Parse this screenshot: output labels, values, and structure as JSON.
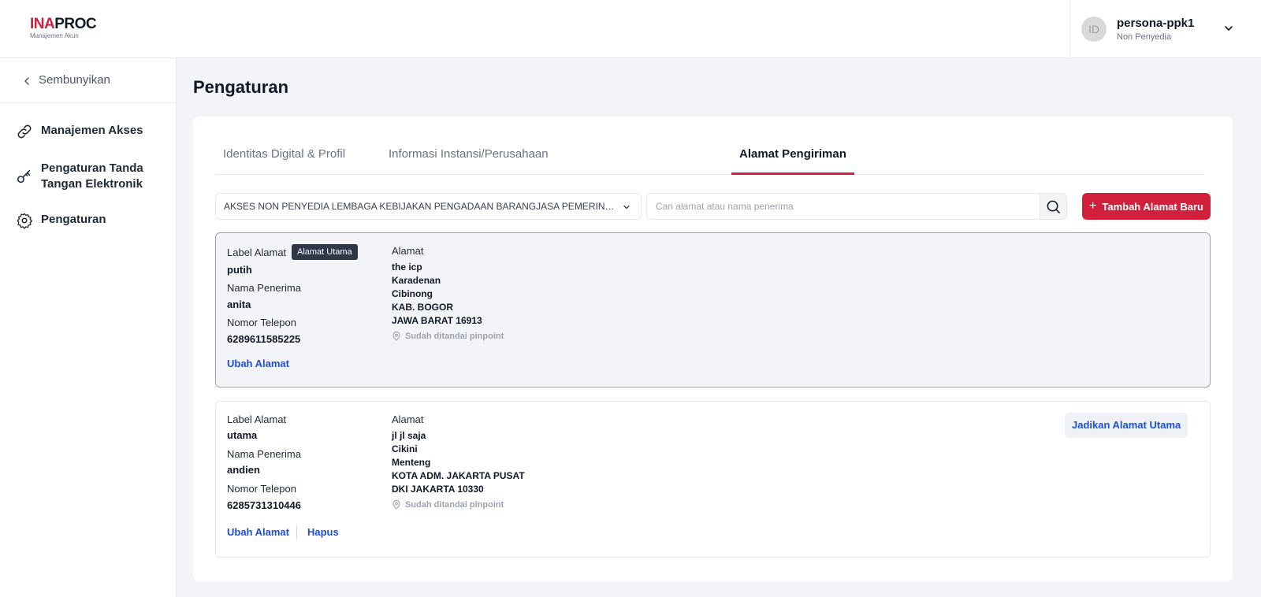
{
  "header": {
    "logo": {
      "ina": "INA",
      "proc": "PROC",
      "subtitle": "Manajemen Akun"
    },
    "user": {
      "avatar_initials": "ID",
      "name": "persona-ppk1",
      "role": "Non Penyedia"
    }
  },
  "sidebar": {
    "hide_label": "Sembunyikan",
    "items": [
      {
        "label": "Manajemen Akses",
        "icon": "link-icon"
      },
      {
        "label_line1": "Pengaturan Tanda",
        "label_line2": "Tangan Elektronik",
        "icon": "key-icon"
      },
      {
        "label": "Pengaturan",
        "icon": "gear-icon"
      }
    ]
  },
  "main": {
    "title": "Pengaturan",
    "tabs": [
      {
        "label": "Identitas Digital & Profil"
      },
      {
        "label": "Informasi Instansi/Perusahaan"
      },
      {
        "label": "Alamat Pengiriman",
        "active": true
      }
    ],
    "filter": {
      "selected": "AKSES NON PENYEDIA LEMBAGA KEBIJAKAN PENGADAAN BARANGJASA PEMERINTAH - PUSAT"
    },
    "search": {
      "placeholder": "Cari alamat atau nama penerima",
      "value": ""
    },
    "add_button": "Tambah Alamat Baru",
    "addresses": [
      {
        "label_title": "Label Alamat",
        "label": "putih",
        "badge": "Alamat Utama",
        "recipient_title": "Nama Penerima",
        "recipient": "anita",
        "phone_title": "Nomor Telepon",
        "phone": "6289611585225",
        "address_title": "Alamat",
        "address_lines": [
          "the icp",
          "Karadenan",
          "Cibinong",
          "KAB. BOGOR",
          "JAWA BARAT 16913"
        ],
        "pinpoint": "Sudah ditandai pinpoint",
        "edit": "Ubah Alamat"
      },
      {
        "label_title": "Label Alamat",
        "label": "utama",
        "recipient_title": "Nama Penerima",
        "recipient": "andien",
        "phone_title": "Nomor Telepon",
        "phone": "6285731310446",
        "address_title": "Alamat",
        "address_lines": [
          "jl jl saja",
          "Cikini",
          "Menteng",
          "KOTA ADM. JAKARTA PUSAT",
          "DKI JAKARTA 10330"
        ],
        "pinpoint": "Sudah ditandai pinpoint",
        "edit": "Ubah Alamat",
        "delete": "Hapus",
        "make_primary": "Jadikan Alamat Utama"
      }
    ]
  }
}
